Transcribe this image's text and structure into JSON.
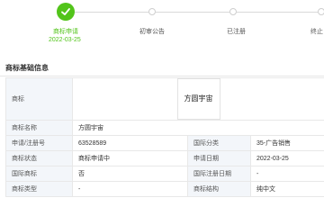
{
  "steps": [
    {
      "label": "商标申请",
      "date": "2022-03-25",
      "status": "done",
      "icon": "check-icon"
    },
    {
      "label": "初审公告",
      "status": "pending"
    },
    {
      "label": "已注册",
      "status": "pending"
    },
    {
      "label": "终止",
      "status": "pending"
    }
  ],
  "section": {
    "title": "商标基础信息"
  },
  "table": {
    "image_label": "商标",
    "trademark_image_text": "方圆宇宙",
    "rows": [
      {
        "k1": "商标名称",
        "v1": "方圆宇宙",
        "k2": "",
        "v2": ""
      },
      {
        "k1": "申请/注册号",
        "v1": "63528589",
        "k2": "国际分类",
        "v2": "35-广告销售"
      },
      {
        "k1": "商标状态",
        "v1": "商标申请中",
        "k2": "申请日期",
        "v2": "2022-03-25"
      },
      {
        "k1": "国际商标",
        "v1": "否",
        "k2": "国际注册日期",
        "v2": "-"
      },
      {
        "k1": "商标类型",
        "v1": "-",
        "k2": "商标结构",
        "v2": "纯中文"
      }
    ]
  },
  "colors": {
    "done": "#52c41a",
    "label_bg": "#f3f6fa",
    "border": "#e8e8e8"
  }
}
